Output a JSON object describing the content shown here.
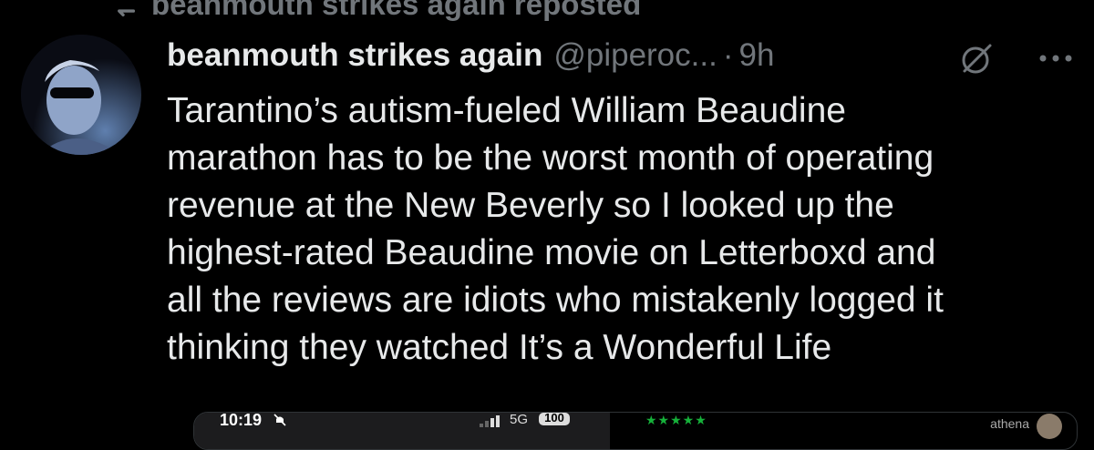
{
  "repost_header": {
    "text": "beanmouth strikes again reposted"
  },
  "tweet": {
    "display_name": "beanmouth strikes again",
    "handle": "@piperoc...",
    "separator": "·",
    "time": "9h",
    "lines": [
      "Tarantino’s autism-fueled William Beaudine",
      "marathon has to be the worst month of operating",
      "revenue at the New Beverly so I looked up the",
      "highest-rated Beaudine movie on Letterboxd and",
      "all the reviews are idiots who mistakenly logged it",
      "thinking they watched It’s a Wonderful Life"
    ]
  },
  "embed": {
    "status_time": "10:19",
    "network": "5G",
    "battery": "100",
    "stars": "★★★★★",
    "username": "athena"
  },
  "icons": {
    "repost": "repost-icon",
    "grok": "grok-icon",
    "more": "more-icon",
    "bell": "bell-off-icon",
    "signal": "signal-icon"
  },
  "colors": {
    "background": "#000000",
    "text": "#e7e9ea",
    "secondary": "#71767b",
    "stars": "#16b13a"
  }
}
